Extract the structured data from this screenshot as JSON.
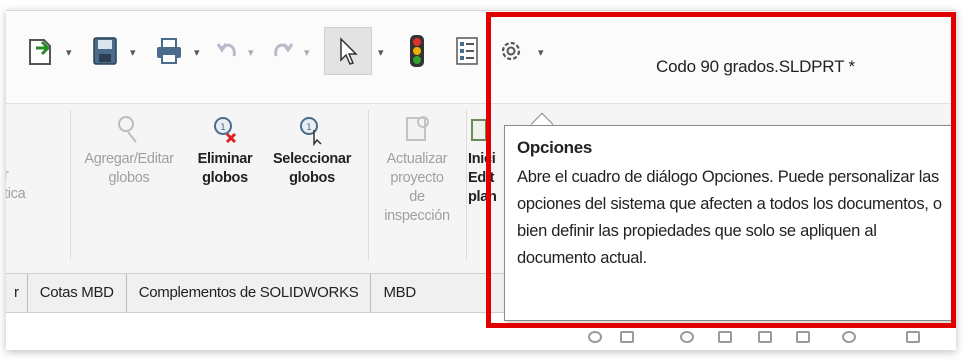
{
  "window": {
    "document_title": "Codo 90 grados.SLDPRT *"
  },
  "quick_access": {
    "icons": [
      "new-document-icon",
      "save-icon",
      "print-icon",
      "undo-icon",
      "redo-icon",
      "select-arrow-icon",
      "traffic-light-icon",
      "file-properties-icon",
      "gear-icon"
    ],
    "caret": "▾"
  },
  "ribbon": {
    "buttons": [
      {
        "label": "r\ntica",
        "state": "disabled"
      },
      {
        "label": "Agregar/Editar\nglobos",
        "state": "disabled"
      },
      {
        "label": "Eliminar\nglobos",
        "state": "enabled"
      },
      {
        "label": "Seleccionar\nglobos",
        "state": "enabled"
      },
      {
        "label": "Actualizar\nproyecto\nde\ninspección",
        "state": "disabled"
      },
      {
        "label": "Inici\nEdit\nplan",
        "state": "enabled"
      }
    ]
  },
  "tabs": [
    "r",
    "Cotas MBD",
    "Complementos de SOLIDWORKS",
    "MBD"
  ],
  "tooltip": {
    "title": "Opciones",
    "body": "Abre el cuadro de diálogo Opciones. Puede personalizar las opciones del sistema que afecten a todos los documentos, o bien definir las propiedades que solo se apliquen al documento actual."
  },
  "colors": {
    "highlight": "#e00000",
    "tooltip_border": "#8a8a8a",
    "ribbon_bg": "#f5f5f5"
  }
}
